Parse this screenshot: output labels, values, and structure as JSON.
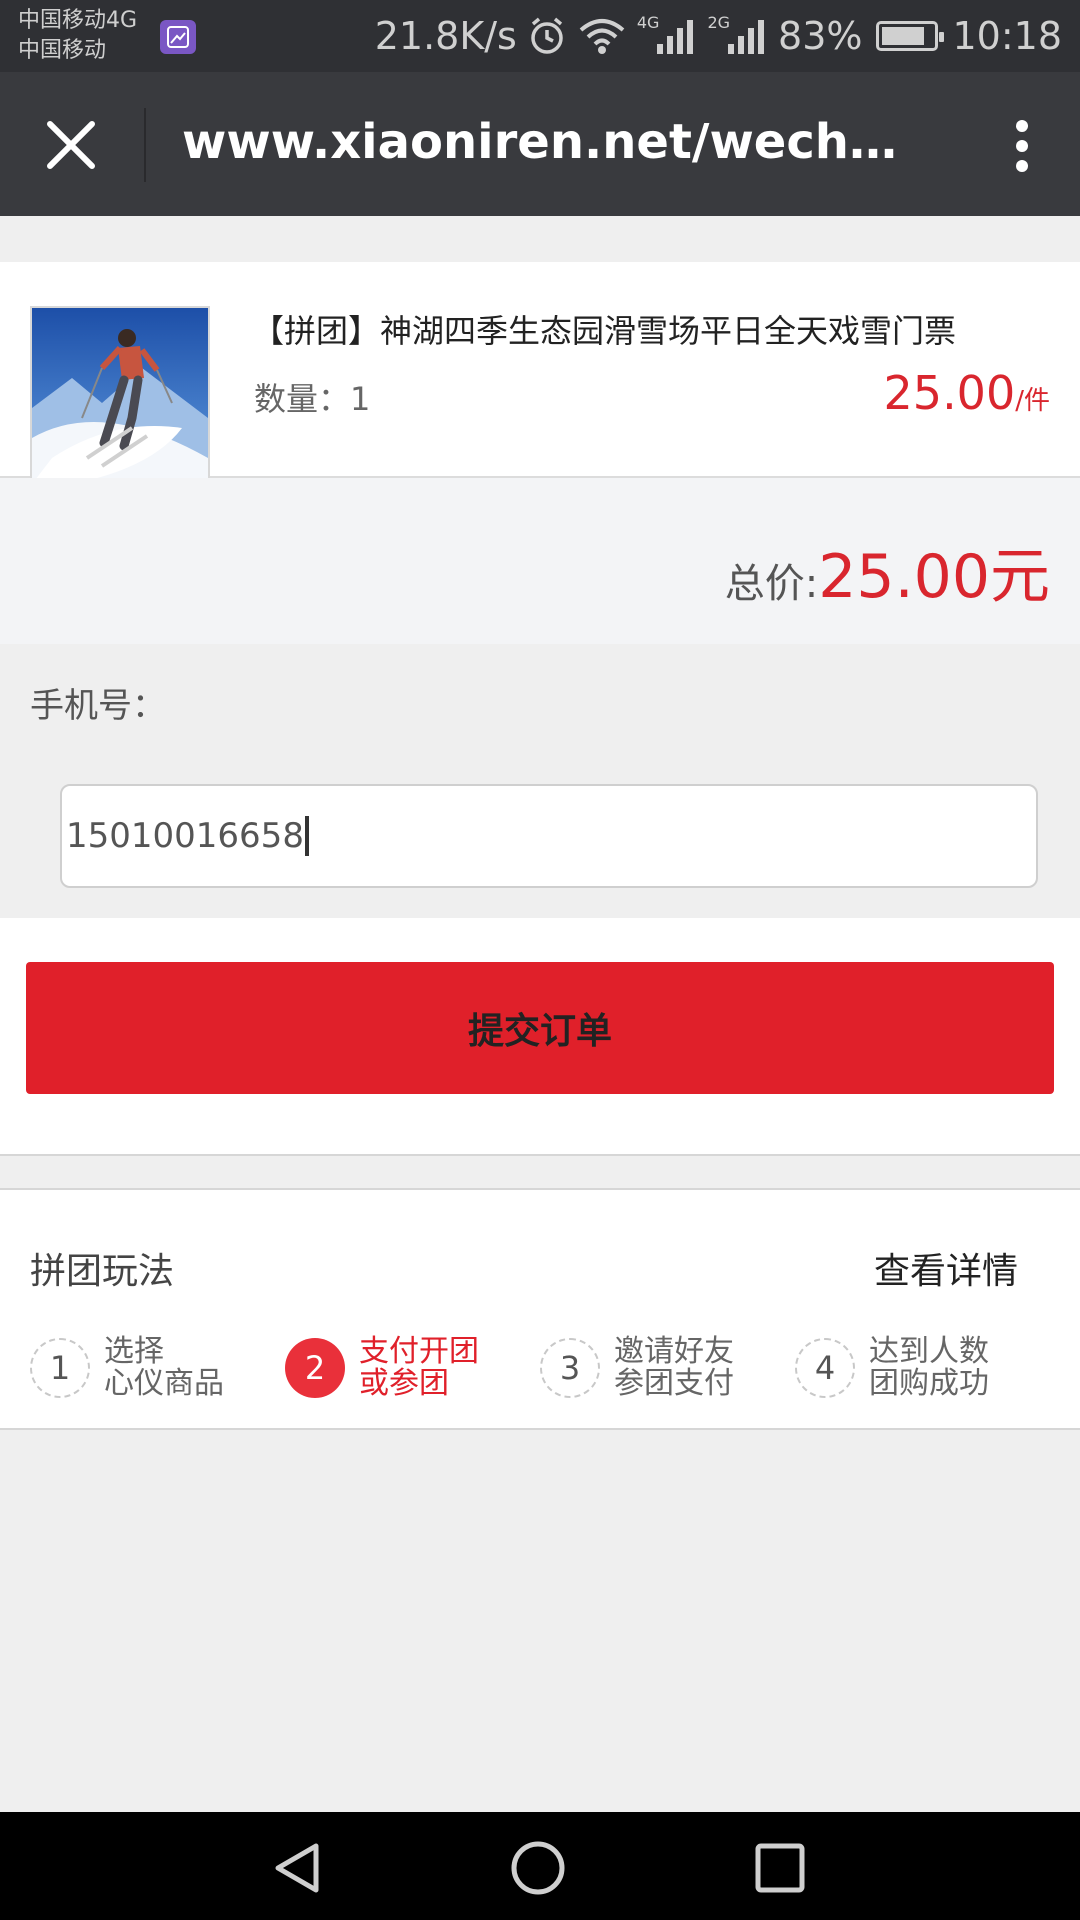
{
  "status_bar": {
    "carrier_line1": "中国移动4G",
    "carrier_line2": "中国移动",
    "speed": "21.8K/s",
    "signal_4g": "4G",
    "signal_2g": "2G",
    "battery_percent_text": "83%",
    "battery_level": 0.83,
    "time": "10:18"
  },
  "browser": {
    "url": "www.xiaoniren.net/wechat/s..."
  },
  "product": {
    "title": "【拼团】神湖四季生态园滑雪场平日全天戏雪门票",
    "quantity_label": "数量：",
    "quantity": "1",
    "price": "25.00",
    "price_unit": "/件"
  },
  "total": {
    "label": "总价:",
    "value": "25.00元"
  },
  "phone": {
    "label": "手机号：",
    "value": "15010016658"
  },
  "submit": {
    "label": "提交订单"
  },
  "rules": {
    "title": "拼团玩法",
    "link": "查看详情",
    "steps": [
      {
        "num": "1",
        "line1": "选择",
        "line2": "心仪商品"
      },
      {
        "num": "2",
        "line1": "支付开团",
        "line2": "或参团"
      },
      {
        "num": "3",
        "line1": "邀请好友",
        "line2": "参团支付"
      },
      {
        "num": "4",
        "line1": "达到人数",
        "line2": "团购成功"
      }
    ],
    "active_step": 2
  },
  "colors": {
    "accent_red": "#e0202a",
    "price_red": "#d9262e",
    "status_bar": "#2f3034",
    "browser_bar": "#393a3e"
  },
  "icons": {
    "close": "close-icon",
    "more": "more-vertical-icon",
    "alarm": "alarm-icon",
    "wifi": "wifi-icon",
    "back": "back-triangle-icon",
    "home": "home-circle-icon",
    "recents": "recents-square-icon"
  }
}
